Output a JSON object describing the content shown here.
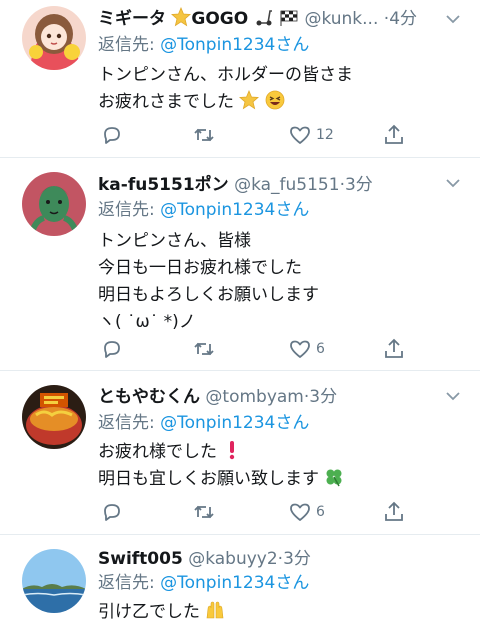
{
  "tweets": [
    {
      "name": "ミギータ",
      "name_suffix": "GOGO",
      "handle": "@kunk...",
      "dot": "·",
      "time": "4分",
      "reply_prefix": "返信先: ",
      "reply_to": "@Tonpin1234さん",
      "lines": [
        "トンピンさん、ホルダーの皆さま",
        "お疲れさまでした"
      ],
      "reply_count": "",
      "retweet_count": "",
      "like_count": "12"
    },
    {
      "name": "ka-fu5151ポン",
      "handle": "@ka_fu5151",
      "dot": "·",
      "time": "3分",
      "reply_prefix": "返信先: ",
      "reply_to": "@Tonpin1234さん",
      "lines": [
        "トンピンさん、皆様",
        "今日も一日お疲れ様でした",
        "明日もよろしくお願いします",
        "ヽ( ˙ω˙ *)ノ"
      ],
      "reply_count": "",
      "retweet_count": "",
      "like_count": "6"
    },
    {
      "name": "ともやむくん",
      "handle": "@tombyam",
      "dot": "·",
      "time": "3分",
      "reply_prefix": "返信先: ",
      "reply_to": "@Tonpin1234さん",
      "lines": [
        "お疲れ様でした",
        "明日も宜しくお願い致します"
      ],
      "reply_count": "",
      "retweet_count": "",
      "like_count": "6"
    },
    {
      "name": "Swift005",
      "handle": "@kabuyy2",
      "dot": "·",
      "time": "3分",
      "reply_prefix": "返信先: ",
      "reply_to": "@Tonpin1234さん",
      "lines": [
        "引け乙でした"
      ]
    }
  ],
  "icons": {
    "reply": "reply-icon",
    "retweet": "retweet-icon",
    "like": "heart-icon",
    "share": "share-icon",
    "menu": "chevron-down-icon"
  },
  "colors": {
    "text": "#14171a",
    "secondary": "#657786",
    "link": "#1b95e0",
    "divider": "#e6ecf0"
  }
}
